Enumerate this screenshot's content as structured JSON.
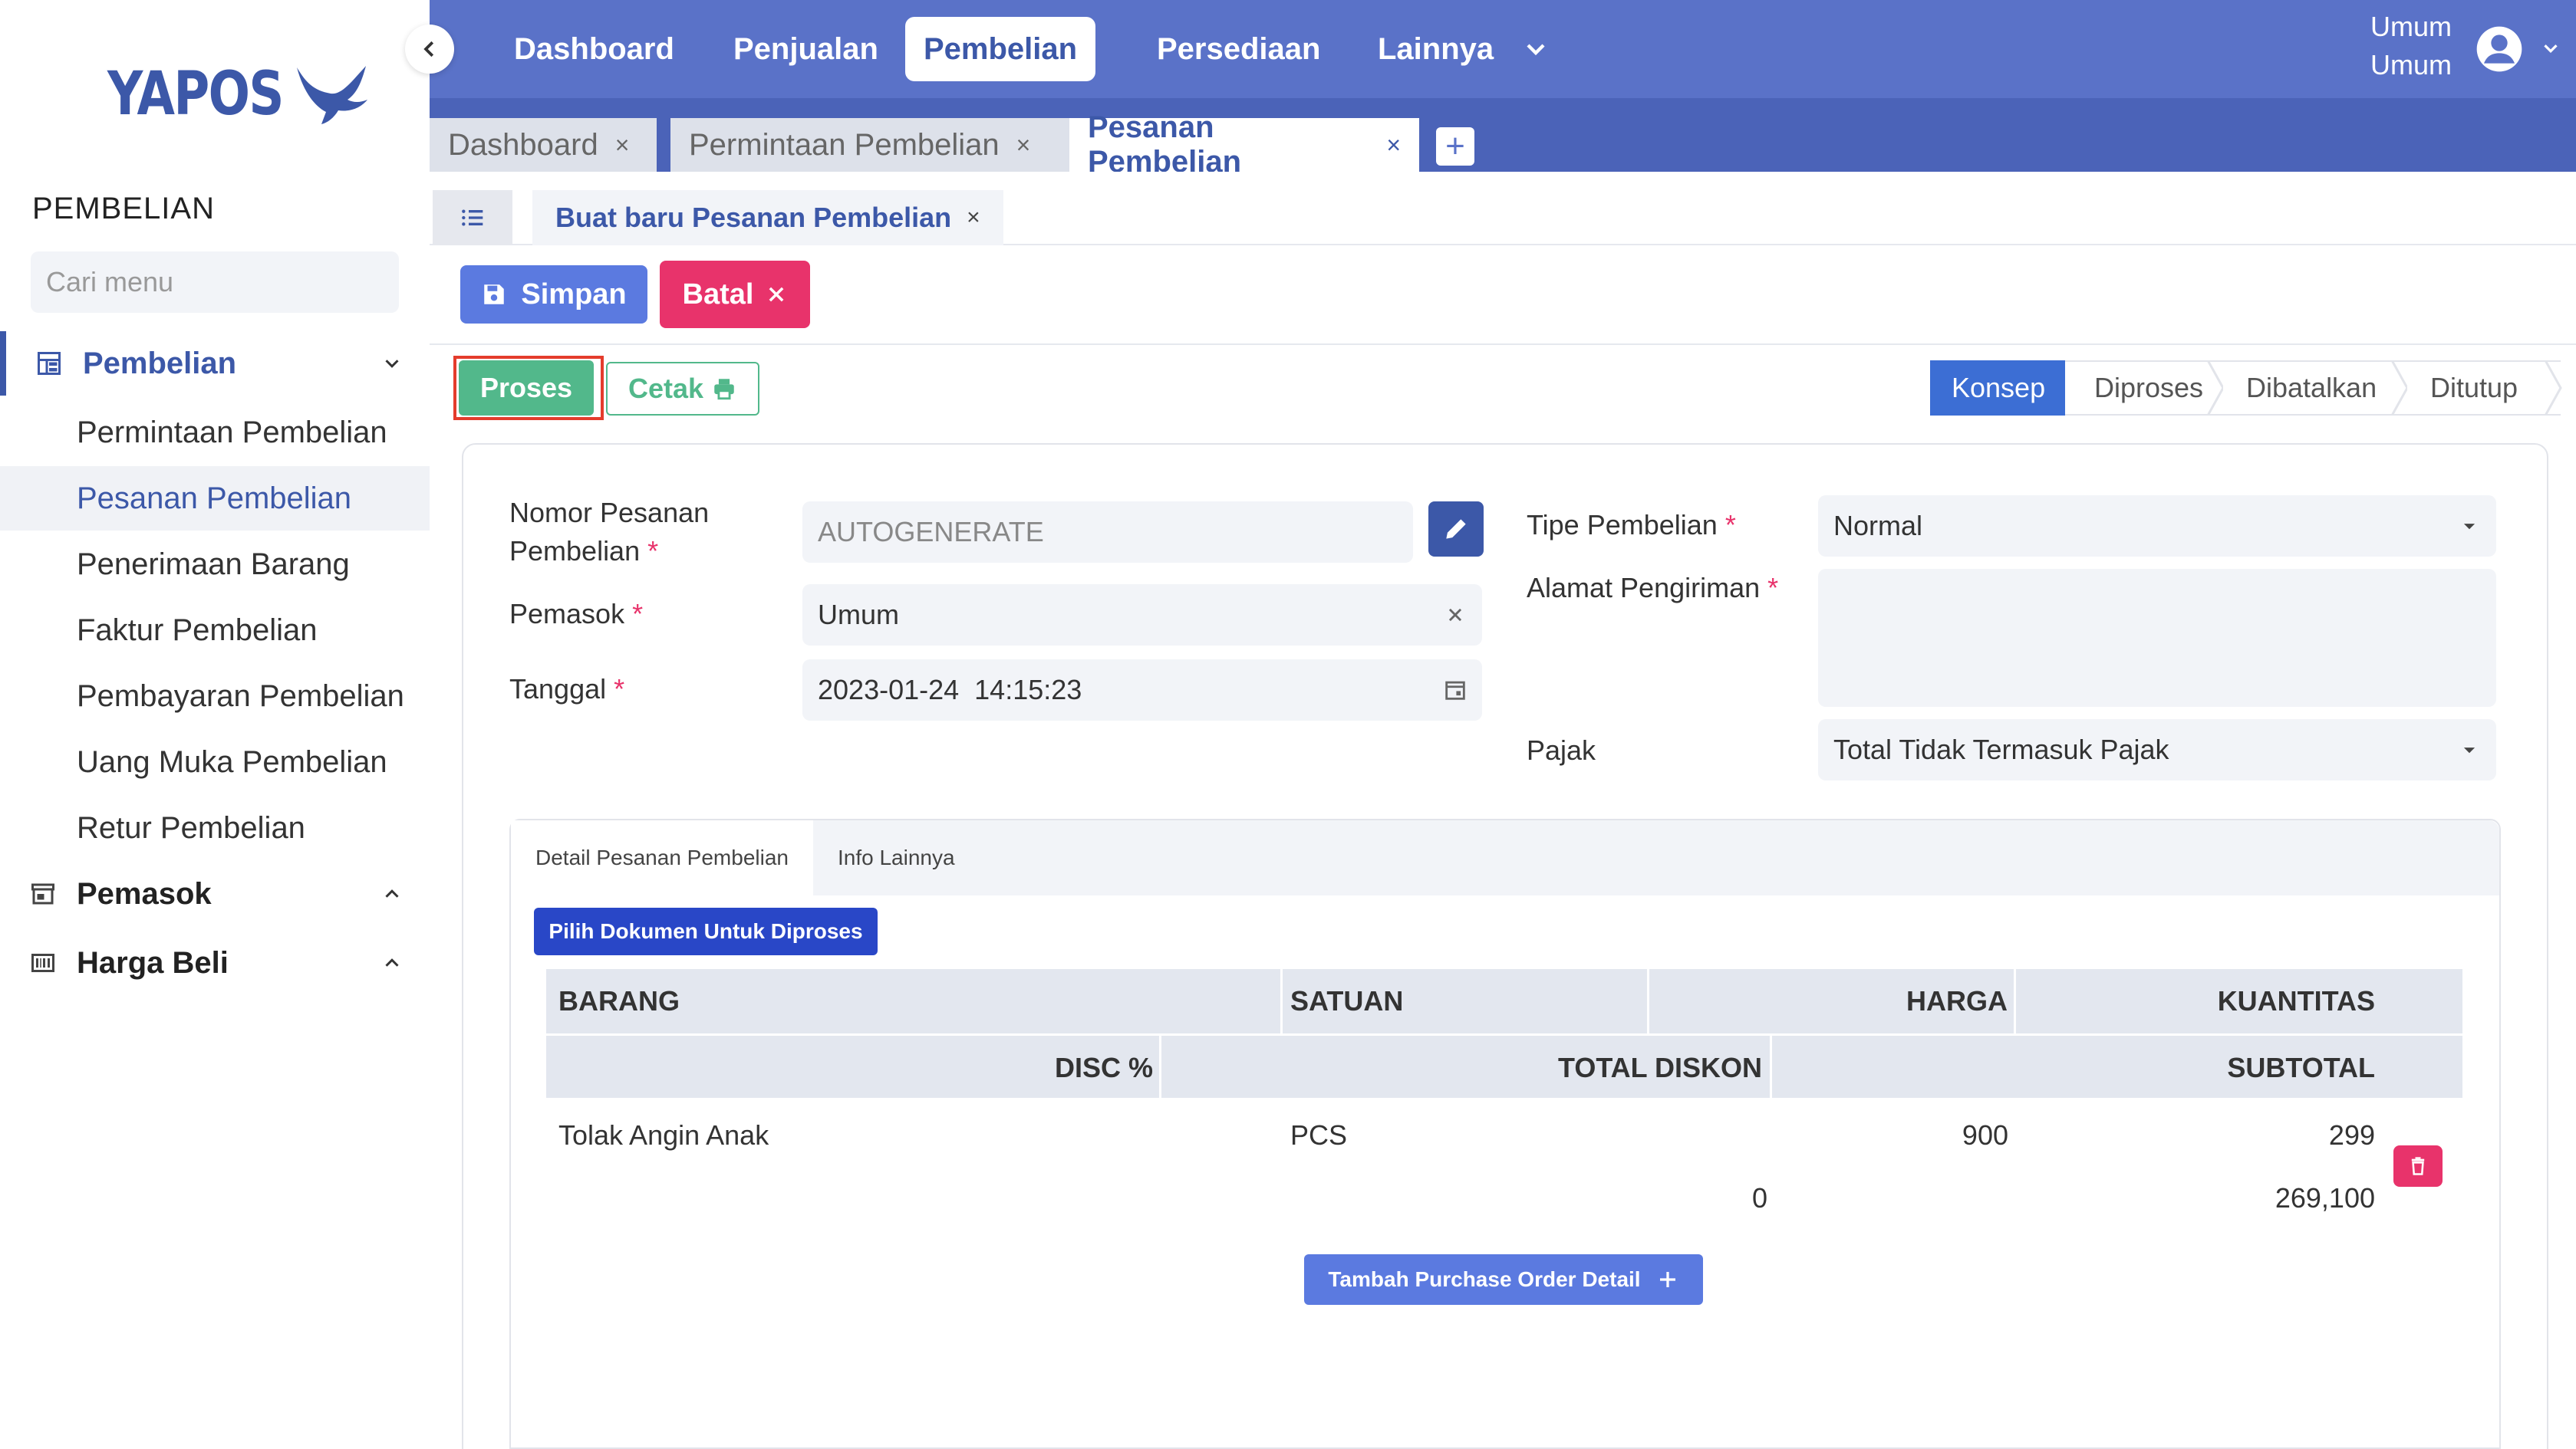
{
  "brand": {
    "name": "YAPOS",
    "color": "#3c58a8"
  },
  "sidebar": {
    "section_title": "PEMBELIAN",
    "search_placeholder": "Cari menu",
    "groups": [
      {
        "label": "Pembelian",
        "icon": "dashboard-icon",
        "expanded": true,
        "items": [
          "Permintaan Pembelian",
          "Pesanan Pembelian",
          "Penerimaan Barang",
          "Faktur Pembelian",
          "Pembayaran Pembelian",
          "Uang Muka Pembelian",
          "Retur Pembelian"
        ]
      },
      {
        "label": "Pemasok",
        "icon": "store-icon",
        "expanded": false
      },
      {
        "label": "Harga Beli",
        "icon": "barcode-icon",
        "expanded": false
      }
    ],
    "selected_item": "Pesanan Pembelian"
  },
  "topnav": {
    "items": [
      "Dashboard",
      "Penjualan",
      "Pembelian",
      "Persediaan",
      "Lainnya"
    ],
    "active": "Pembelian",
    "user": {
      "line1": "Umum",
      "line2": "Umum"
    }
  },
  "tabs": {
    "items": [
      "Dashboard",
      "Permintaan Pembelian",
      "Pesanan Pembelian"
    ],
    "active": "Pesanan Pembelian",
    "close_glyph": "×",
    "add_glyph": "+"
  },
  "subtab": {
    "label": "Buat baru Pesanan Pembelian",
    "close_glyph": "×"
  },
  "actions": {
    "save": "Simpan",
    "cancel": "Batal",
    "process": "Proses",
    "print": "Cetak"
  },
  "statuses": {
    "items": [
      "Konsep",
      "Diproses",
      "Dibatalkan",
      "Ditutup"
    ],
    "active": "Konsep"
  },
  "form": {
    "nomor_label_1": "Nomor Pesanan",
    "nomor_label_2": "Pembelian",
    "nomor_value": "AUTOGENERATE",
    "pemasok_label": "Pemasok",
    "pemasok_value": "Umum",
    "tanggal_label": "Tanggal",
    "tanggal_value": "2023-01-24  14:15:23",
    "tipe_label": "Tipe Pembelian",
    "tipe_value": "Normal",
    "alamat_label": "Alamat Pengiriman",
    "alamat_value": "",
    "pajak_label": "Pajak",
    "pajak_value": "Total Tidak Termasuk Pajak",
    "required_mark": "*"
  },
  "detail": {
    "tabs": [
      "Detail Pesanan Pembelian",
      "Info Lainnya"
    ],
    "active_tab": "Detail Pesanan Pembelian",
    "pick_button": "Pilih Dokumen Untuk Diproses",
    "headers_row1": [
      "BARANG",
      "SATUAN",
      "HARGA",
      "KUANTITAS"
    ],
    "headers_row2": [
      "DISC %",
      "TOTAL DISKON",
      "SUBTOTAL"
    ],
    "rows": [
      {
        "barang": "Tolak Angin Anak",
        "satuan": "PCS",
        "harga": "900",
        "kuantitas": "299",
        "disc": "",
        "total_diskon": "0",
        "subtotal": "269,100"
      }
    ],
    "add_button": "Tambah Purchase Order Detail"
  },
  "colors": {
    "primary": "#5a72c8",
    "success": "#52b88b",
    "danger": "#e8336b",
    "status_active": "#3c6ed4"
  }
}
